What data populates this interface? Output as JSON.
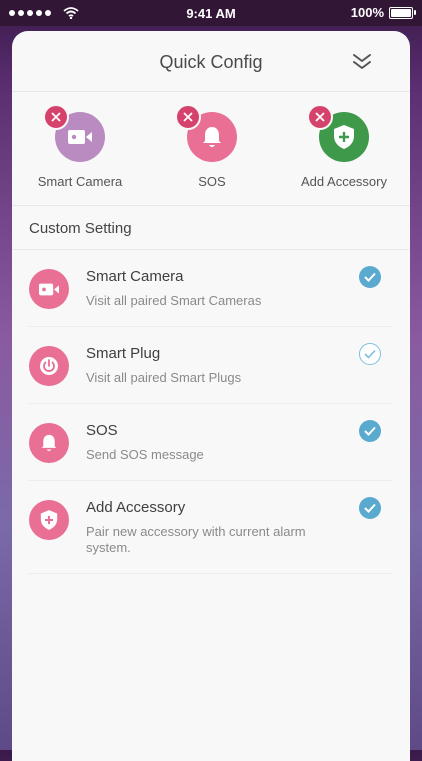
{
  "status_bar": {
    "time": "9:41 AM",
    "battery": "100%"
  },
  "header": {
    "title": "Quick Config"
  },
  "quick_items": [
    {
      "label": "Smart Camera",
      "icon": "video-camera-icon",
      "color": "#b98bc0"
    },
    {
      "label": "SOS",
      "icon": "bell-icon",
      "color": "#ea6f94"
    },
    {
      "label": "Add Accessory",
      "icon": "shield-plus-icon",
      "color": "#3e9a4a"
    }
  ],
  "custom": {
    "heading": "Custom Setting",
    "items": [
      {
        "title": "Smart Camera",
        "subtitle": "Visit all paired Smart Cameras",
        "icon": "video-camera-icon",
        "checked": true
      },
      {
        "title": "Smart Plug",
        "subtitle": "Visit all paired Smart Plugs",
        "icon": "power-icon",
        "checked": false
      },
      {
        "title": "SOS",
        "subtitle": "Send SOS message",
        "icon": "bell-icon",
        "checked": true
      },
      {
        "title": "Add Accessory",
        "subtitle": "Pair new accessory with current alarm system.",
        "icon": "shield-plus-icon",
        "checked": true
      }
    ]
  },
  "colors": {
    "accent_pink": "#ea6f94",
    "check_blue": "#5aa9cf",
    "remove_red": "#d5436d"
  }
}
